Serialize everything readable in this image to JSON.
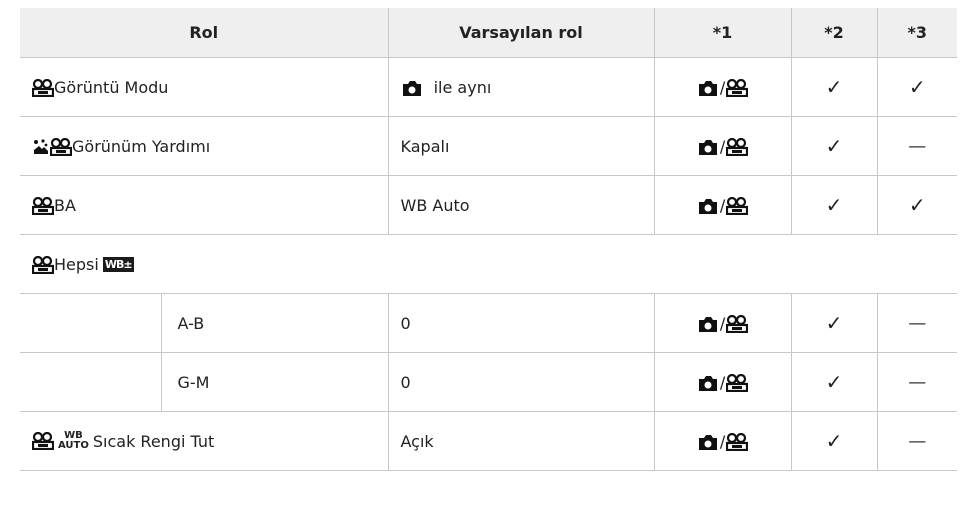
{
  "table": {
    "headers": {
      "rol": "Rol",
      "default": "Varsayılan rol",
      "c1": "*1",
      "c2": "*2",
      "c3": "*3"
    },
    "rows": [
      {
        "label": "Görüntü Modu",
        "default": "ile aynı",
        "c3": "✓"
      },
      {
        "label": "Görünüm Yardımı",
        "default": "Kapalı",
        "c3": "—"
      },
      {
        "label": "BA",
        "default": "WB Auto",
        "c3": "✓"
      },
      {
        "label": "Hepsi",
        "wb_icon": "WB±"
      },
      {
        "sub": "A-B",
        "default": "0",
        "c3": "—"
      },
      {
        "sub": "G-M",
        "default": "0",
        "c3": "—"
      },
      {
        "label": "Sıcak Rengi Tut",
        "wb_auto_top": "WB",
        "wb_auto_bottom": "AUTO",
        "default": "Açık",
        "c3": "—"
      }
    ],
    "check": "✓",
    "slash": "/"
  },
  "icons": [
    "movie-icon",
    "camera-icon",
    "scene-icon",
    "wb-adjust-icon",
    "wb-auto-icon",
    "check-icon",
    "dash-icon"
  ]
}
